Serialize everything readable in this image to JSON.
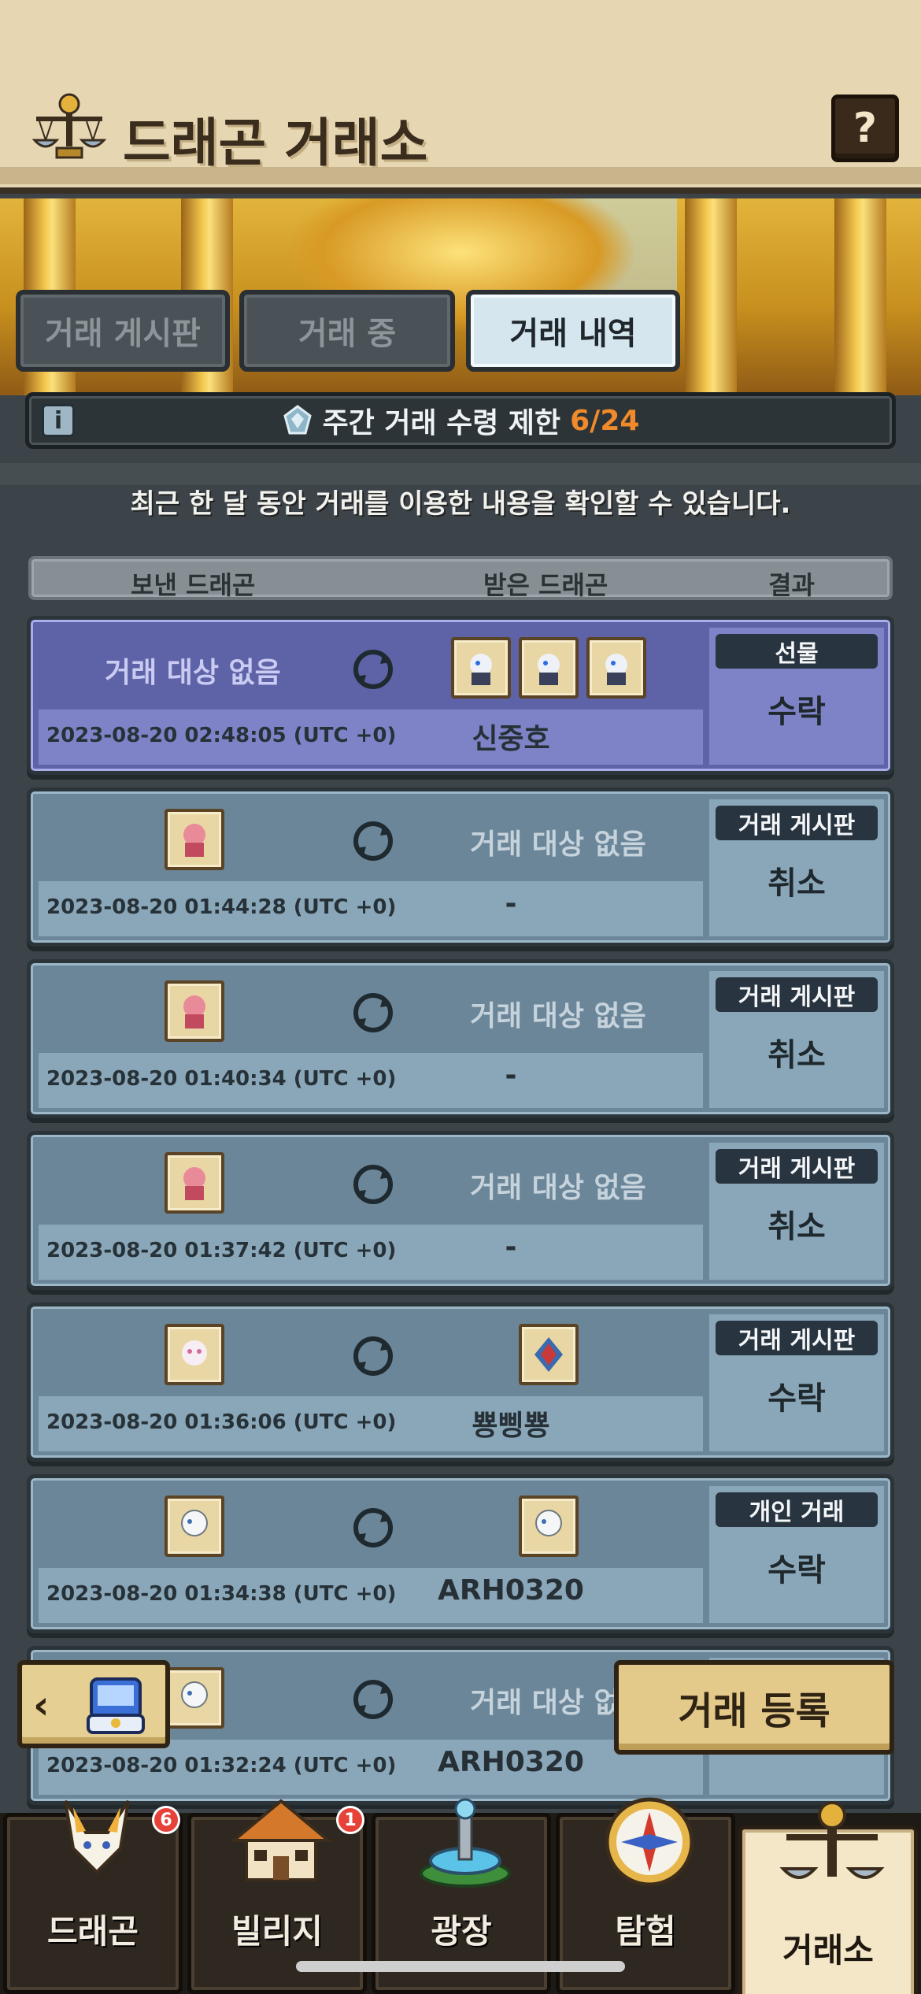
{
  "header": {
    "title": "드래곤 거래소",
    "help_label": "?"
  },
  "tabs": [
    {
      "label": "거래 게시판",
      "active": false
    },
    {
      "label": "거래 중",
      "active": false
    },
    {
      "label": "거래 내역",
      "active": true
    }
  ],
  "limit": {
    "info_label": "i",
    "text": "주간 거래 수령 제한",
    "count": "6/24"
  },
  "notice": "최근 한 달 동안 거래를 이용한 내용을 확인할 수 있습니다.",
  "columns": {
    "sent": "보낸 드래곤",
    "received": "받은 드래곤",
    "result": "결과"
  },
  "rows": [
    {
      "sent_text": "거래 대상 없음",
      "timestamp": "2023-08-20 02:48:05 (UTC +0)",
      "partner": "신중호",
      "type": "선물",
      "result": "수락"
    },
    {
      "recv_text": "거래 대상 없음",
      "timestamp": "2023-08-20 01:44:28 (UTC +0)",
      "partner": "-",
      "type": "거래 게시판",
      "result": "취소"
    },
    {
      "recv_text": "거래 대상 없음",
      "timestamp": "2023-08-20 01:40:34 (UTC +0)",
      "partner": "-",
      "type": "거래 게시판",
      "result": "취소"
    },
    {
      "recv_text": "거래 대상 없음",
      "timestamp": "2023-08-20 01:37:42 (UTC +0)",
      "partner": "-",
      "type": "거래 게시판",
      "result": "취소"
    },
    {
      "timestamp": "2023-08-20 01:36:06 (UTC +0)",
      "partner": "뿅삥뿅",
      "type": "거래 게시판",
      "result": "수락"
    },
    {
      "timestamp": "2023-08-20 01:34:38 (UTC +0)",
      "partner": "ARH0320",
      "type": "개인 거래",
      "result": "수락"
    },
    {
      "recv_text": "거래 대상 없음",
      "timestamp": "2023-08-20 01:32:24 (UTC +0)",
      "partner": "ARH0320"
    }
  ],
  "buttons": {
    "back_label": "‹",
    "register_label": "거래 등록"
  },
  "nav": [
    {
      "label": "드래곤",
      "badge": "6"
    },
    {
      "label": "빌리지",
      "badge": "1"
    },
    {
      "label": "광장"
    },
    {
      "label": "탐험"
    },
    {
      "label": "거래소",
      "active": true
    }
  ],
  "colors": {
    "accent_orange": "#f08a2a",
    "gift_row": "#5e62a6",
    "row": "#6a8698"
  },
  "icons": [
    "scales-icon",
    "help-icon",
    "info-icon",
    "gem-icon",
    "swap-icon",
    "dragon-thumbnail",
    "chevron-left-icon",
    "chest-icon",
    "dragon-icon",
    "village-icon",
    "fountain-icon",
    "compass-icon"
  ]
}
